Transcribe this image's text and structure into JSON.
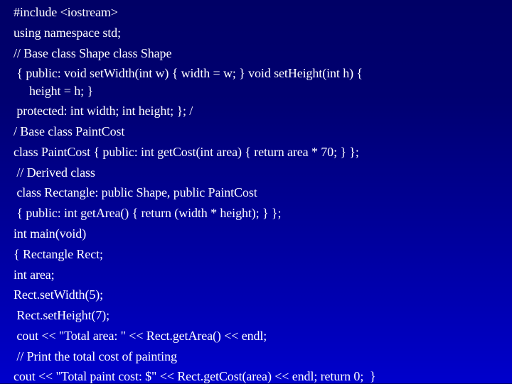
{
  "slide": {
    "background_top": "#000066",
    "background_bottom": "#0000CC",
    "text_color": "#FFFFFF",
    "lines": [
      "#include <iostream>",
      "using namespace std;",
      "// Base class Shape class Shape",
      " { public: void setWidth(int w) { width = w; } void setHeight(int h) {",
      "     height = h; }",
      " protected: int width; int height; }; /",
      "/ Base class PaintCost",
      "class PaintCost { public: int getCost(int area) { return area * 70; } };",
      " // Derived class",
      " class Rectangle: public Shape, public PaintCost",
      " { public: int getArea() { return (width * height); } };",
      "int main(void)",
      "{ Rectangle Rect;",
      "int area;",
      "Rect.setWidth(5);",
      " Rect.setHeight(7);",
      " cout << \"Total area: \" << Rect.getArea() << endl;",
      " // Print the total cost of painting",
      "cout << \"Total paint cost: $\" << Rect.getCost(area) << endl; return 0;  }"
    ]
  }
}
